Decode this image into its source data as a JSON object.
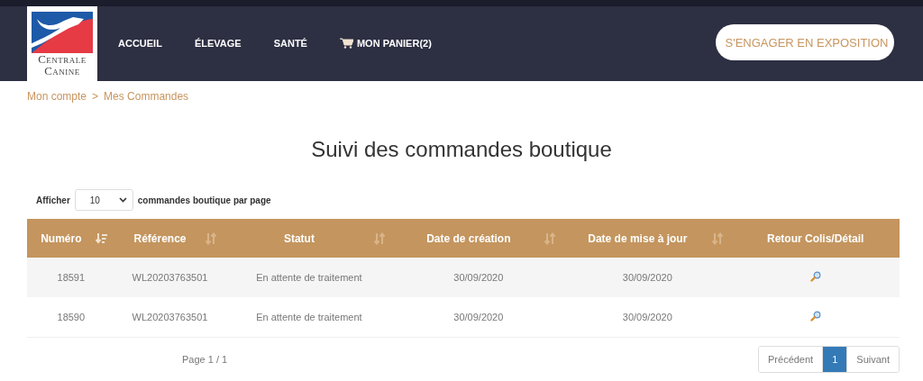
{
  "header": {
    "logo": {
      "line1": "Centrale",
      "line2": "Canine"
    },
    "nav": [
      {
        "label": "ACCUEIL",
        "kind": "link"
      },
      {
        "label": "ÉLEVAGE",
        "kind": "link"
      },
      {
        "label": "SANTÉ",
        "kind": "link"
      },
      {
        "label": "MON PANIER(2)",
        "kind": "cart"
      }
    ],
    "cta": "S'ENGAGER EN EXPOSITION"
  },
  "breadcrumb": [
    "Mon compte",
    "Mes Commandes"
  ],
  "breadcrumb_separator": ">",
  "title": "Suivi des commandes boutique",
  "page_size": {
    "before": "Afficher",
    "value": "10",
    "after": "commandes boutique par page"
  },
  "table": {
    "columns": [
      {
        "label": "Numéro",
        "sorted": true
      },
      {
        "label": "Référence",
        "sorted": false
      },
      {
        "label": "Statut",
        "sorted": false
      },
      {
        "label": "Date de création",
        "sorted": false
      },
      {
        "label": "Date de mise à jour",
        "sorted": false
      },
      {
        "label": "Retour Colis/Détail"
      }
    ],
    "rows": [
      {
        "cells": [
          "18591",
          "WL20203763501",
          "En attente de traitement",
          "30/09/2020",
          "30/09/2020"
        ]
      },
      {
        "cells": [
          "18590",
          "WL20203763501",
          "En attente de traitement",
          "30/09/2020",
          "30/09/2020"
        ]
      }
    ]
  },
  "page_info": "Page 1 / 1",
  "pagination": [
    {
      "label": "Précédent",
      "selected": false
    },
    {
      "label": "1",
      "selected": true
    },
    {
      "label": "Suivant",
      "selected": false
    }
  ]
}
